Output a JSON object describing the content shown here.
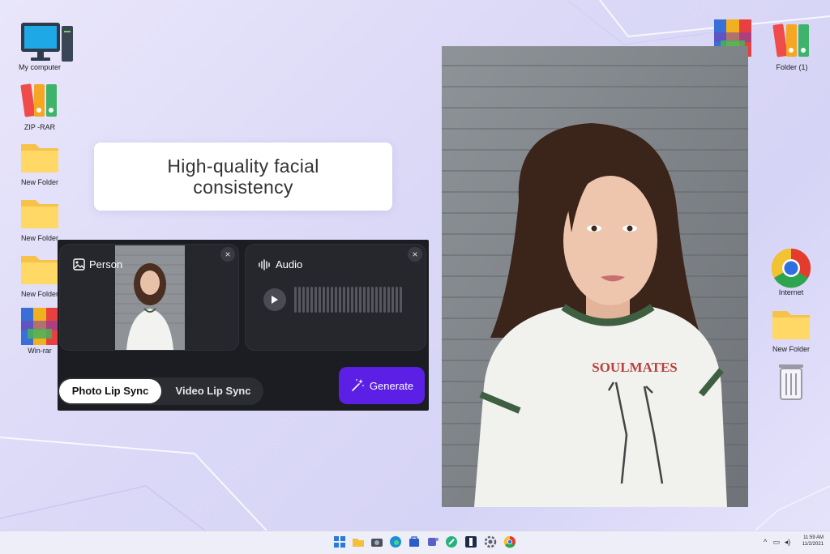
{
  "desktop": {
    "left_icons": [
      {
        "label": "My computer",
        "icon": "computer-icon"
      },
      {
        "label": "ZIP -RAR",
        "icon": "binders-icon"
      },
      {
        "label": "New Folder",
        "icon": "folder-icon"
      },
      {
        "label": "New Folder",
        "icon": "folder-icon"
      },
      {
        "label": "New Folder",
        "icon": "folder-icon"
      },
      {
        "label": "Win-rar",
        "icon": "winrar-icon"
      }
    ],
    "right_icons": [
      {
        "label": "",
        "icon": "winrar-icon"
      },
      {
        "label": "Folder (1)",
        "icon": "binders-icon"
      },
      {
        "label": "Internet",
        "icon": "chrome-icon"
      },
      {
        "label": "New Folder",
        "icon": "folder-icon"
      },
      {
        "label": "",
        "icon": "recycle-bin-icon"
      }
    ]
  },
  "caption": {
    "text": "High-quality facial consistency"
  },
  "app": {
    "person_card": {
      "title": "Person",
      "close": "×"
    },
    "audio_card": {
      "title": "Audio",
      "close": "×"
    },
    "tabs": [
      {
        "label": "Photo Lip Sync",
        "active": true
      },
      {
        "label": "Video Lip Sync",
        "active": false
      }
    ],
    "generate_label": "Generate",
    "accent": "#5b1fe6"
  },
  "photo": {
    "shirt_text": "SOULMATES"
  },
  "taskbar": {
    "icons": [
      "windows-icon",
      "explorer-icon",
      "camera-icon",
      "edge-icon",
      "store-icon",
      "teams-icon",
      "maps-icon",
      "app-icon",
      "settings-icon",
      "chrome-icon"
    ],
    "time": "11:59 AM",
    "date": "11/2/2021"
  }
}
